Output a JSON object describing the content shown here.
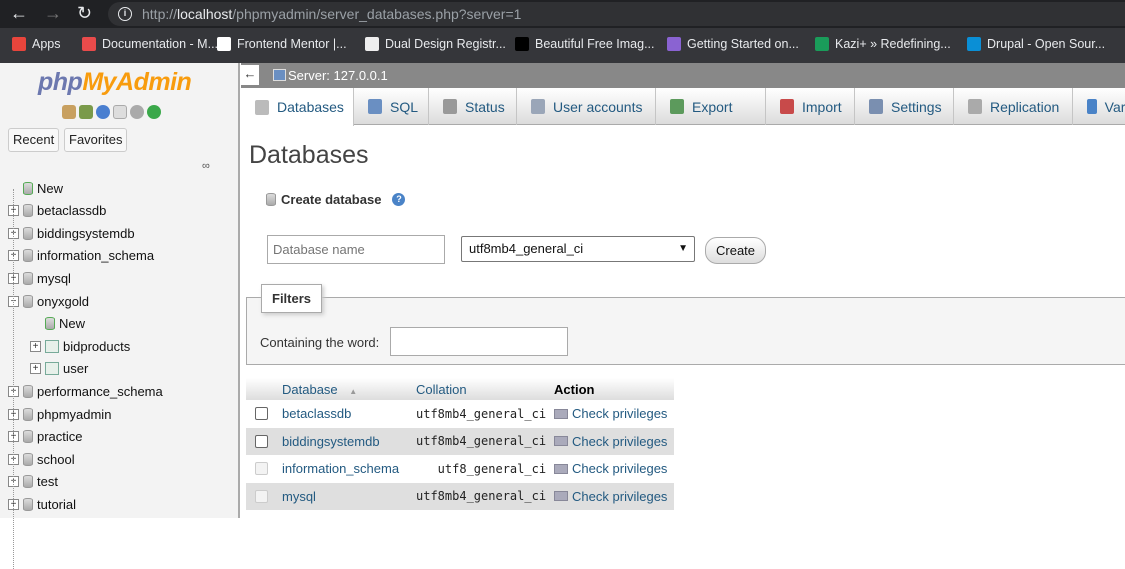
{
  "browser": {
    "url_prefix": "http://",
    "url_host": "localhost",
    "url_path": "/phpmyadmin/server_databases.php?server=1",
    "bookmarks": [
      {
        "label": "Apps",
        "color": "#e8453c"
      },
      {
        "label": "Documentation - M...",
        "color": "#e94b4b"
      },
      {
        "label": "Frontend Mentor |...",
        "color": "#ffffff"
      },
      {
        "label": "Dual Design Registr...",
        "color": "#eeeeee"
      },
      {
        "label": "Beautiful Free Imag...",
        "color": "#000000"
      },
      {
        "label": "Getting Started on...",
        "color": "#8a63d2"
      },
      {
        "label": "Kazi+ » Redefining...",
        "color": "#1a9c5a"
      },
      {
        "label": "Drupal - Open Sour...",
        "color": "#0a8fd6"
      }
    ]
  },
  "sidebar": {
    "logo_php": "php",
    "logo_myadmin": "MyAdmin",
    "recent": "Recent",
    "favorites": "Favorites",
    "link_icon": "∞",
    "tree": [
      {
        "label": "New",
        "level": 0,
        "type": "new"
      },
      {
        "label": "betaclassdb",
        "level": 0,
        "type": "db"
      },
      {
        "label": "biddingsystemdb",
        "level": 0,
        "type": "db"
      },
      {
        "label": "information_schema",
        "level": 0,
        "type": "db"
      },
      {
        "label": "mysql",
        "level": 0,
        "type": "db"
      },
      {
        "label": "onyxgold",
        "level": 0,
        "type": "db-open"
      },
      {
        "label": "New",
        "level": 1,
        "type": "new"
      },
      {
        "label": "bidproducts",
        "level": 1,
        "type": "table"
      },
      {
        "label": "user",
        "level": 1,
        "type": "table"
      },
      {
        "label": "performance_schema",
        "level": 0,
        "type": "db"
      },
      {
        "label": "phpmyadmin",
        "level": 0,
        "type": "db"
      },
      {
        "label": "practice",
        "level": 0,
        "type": "db"
      },
      {
        "label": "school",
        "level": 0,
        "type": "db"
      },
      {
        "label": "test",
        "level": 0,
        "type": "db"
      },
      {
        "label": "tutorial",
        "level": 0,
        "type": "db"
      }
    ]
  },
  "server": {
    "back": "←",
    "label": "Server: 127.0.0.1"
  },
  "tabs": [
    {
      "label": "Databases",
      "color": "#bbbbbb"
    },
    {
      "label": "SQL",
      "color": "#6a8fc2"
    },
    {
      "label": "Status",
      "color": "#999999"
    },
    {
      "label": "User accounts",
      "color": "#9aa6b8"
    },
    {
      "label": "Export",
      "color": "#5c9a5c"
    },
    {
      "label": "Import",
      "color": "#c84a4a"
    },
    {
      "label": "Settings",
      "color": "#7a8fb0"
    },
    {
      "label": "Replication",
      "color": "#aaaaaa"
    },
    {
      "label": "Variables",
      "color": "#4a83c7"
    }
  ],
  "page": {
    "title": "Databases",
    "create_db": "Create database",
    "help": "?",
    "db_name_placeholder": "Database name",
    "collation": "utf8mb4_general_ci",
    "create_btn": "Create",
    "filters": "Filters",
    "containing": "Containing the word:"
  },
  "table": {
    "headers": [
      "Database",
      "Collation",
      "Action"
    ],
    "sort_icon": "▲",
    "rows": [
      {
        "db": "betaclassdb",
        "collation": "utf8mb4_general_ci",
        "action": "Check privileges",
        "disabled": false
      },
      {
        "db": "biddingsystemdb",
        "collation": "utf8mb4_general_ci",
        "action": "Check privileges",
        "disabled": false
      },
      {
        "db": "information_schema",
        "collation": "utf8_general_ci",
        "action": "Check privileges",
        "disabled": true
      },
      {
        "db": "mysql",
        "collation": "utf8mb4_general_ci",
        "action": "Check privileges",
        "disabled": true
      }
    ]
  }
}
